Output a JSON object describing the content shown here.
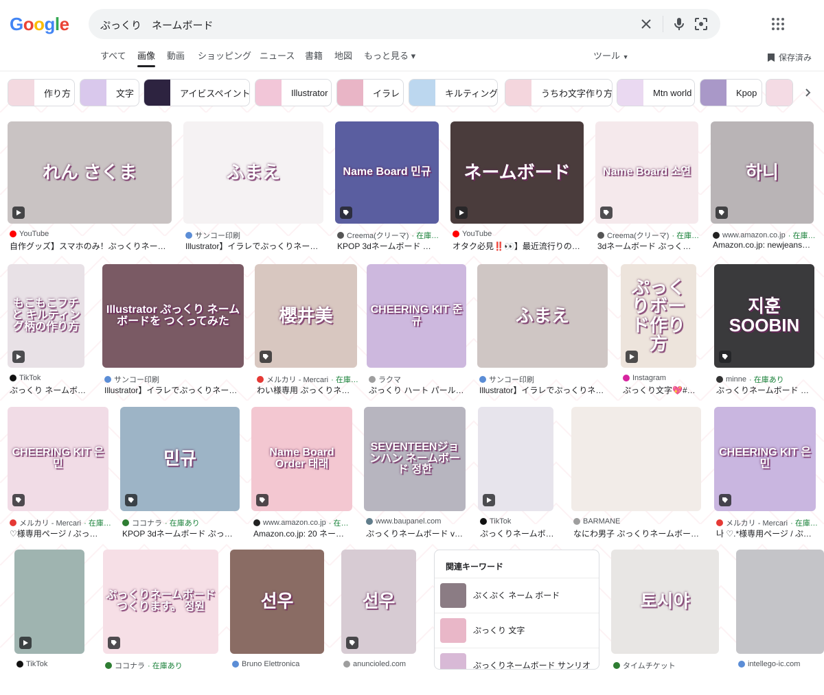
{
  "logo": {
    "letters": [
      "G",
      "o",
      "o",
      "g",
      "l",
      "e"
    ],
    "colors": [
      "#4285F4",
      "#EA4335",
      "#FBBC05",
      "#4285F4",
      "#34A853",
      "#EA4335"
    ]
  },
  "search": {
    "query": "ぷっくり　ネームボード"
  },
  "tabs": [
    {
      "label": "すべて",
      "active": false
    },
    {
      "label": "画像",
      "active": true
    },
    {
      "label": "動画",
      "active": false
    },
    {
      "label": "ショッピング",
      "active": false
    },
    {
      "label": "ニュース",
      "active": false
    },
    {
      "label": "書籍",
      "active": false
    },
    {
      "label": "地図",
      "active": false
    },
    {
      "label": "もっと見る",
      "active": false
    }
  ],
  "tools_label": "ツール",
  "saved_label": "保存済み",
  "chips": [
    {
      "label": "作り方",
      "color": "#f3d9e0"
    },
    {
      "label": "文字",
      "color": "#d9c8ec"
    },
    {
      "label": "アイビスペイント",
      "color": "#2d2340"
    },
    {
      "label": "Illustrator",
      "color": "#f2c6d8"
    },
    {
      "label": "イラレ",
      "color": "#e9b5c6"
    },
    {
      "label": "キルティング",
      "color": "#bcd7ef"
    },
    {
      "label": "うちわ文字作り方",
      "color": "#f4d6dd"
    },
    {
      "label": "Mtn world",
      "color": "#ead9f1"
    },
    {
      "label": "Kpop",
      "color": "#a998c8"
    },
    {
      "label": "",
      "color": "#f4dbe4"
    }
  ],
  "results": [
    {
      "source": "YouTube",
      "stock": "",
      "title": "自作グッズ】スマホのみ！ぷっくりネー…",
      "overlay": "れん さくま",
      "bg": "#c9c3c3",
      "fav": "#ff0000",
      "badge": "play"
    },
    {
      "source": "サンコー印刷",
      "stock": "",
      "title": "Illustrator】イラレでぷっくりネー…",
      "overlay": "ふまえ",
      "bg": "#f5f2f3",
      "fav": "#5b8dd6",
      "badge": ""
    },
    {
      "source": "Creema(クリーマ)",
      "stock": "在庫…",
      "title": "KPOP 3dネームボード …",
      "overlay": "Name Board 민규",
      "bg": "#5a5ea0",
      "fav": "#555555",
      "badge": "tag"
    },
    {
      "source": "YouTube",
      "stock": "",
      "title": "オタク必見‼️👀】最近流行りの…",
      "overlay": "ネームボード",
      "bg": "#4a3c3c",
      "fav": "#ff0000",
      "badge": "play"
    },
    {
      "source": "Creema(クリーマ)",
      "stock": "在庫…",
      "title": "3dネームボード ぷっく…",
      "overlay": "Name Board 소연",
      "bg": "#f5e9ec",
      "fav": "#555555",
      "badge": "tag"
    },
    {
      "source": "www.amazon.co.jp",
      "stock": "在庫…",
      "title": "Amazon.co.jp: newjeans…",
      "overlay": "하니",
      "bg": "#b9b4b6",
      "fav": "#222222",
      "badge": "tag"
    },
    {
      "source": "TikTok",
      "stock": "",
      "title": "ぷっくり ネームボ…",
      "overlay": "もこもこフチと キルティング柄の作り方",
      "bg": "#e8e1e6",
      "fav": "#111111",
      "badge": "play"
    },
    {
      "source": "サンコー印刷",
      "stock": "",
      "title": "Illustrator】イラレでぷっくりネー…",
      "overlay": "Illustrator ぷっくり ネームボードを つくってみた",
      "bg": "#7a5a64",
      "fav": "#5b8dd6",
      "badge": ""
    },
    {
      "source": "メルカリ - Mercari",
      "stock": "在庫…",
      "title": "わい様専用 ぷっくりネ…",
      "overlay": "櫻井美",
      "bg": "#d8c7c0",
      "fav": "#e53935",
      "badge": "tag"
    },
    {
      "source": "ラクマ",
      "stock": "",
      "title": "ぷっくり ハート パール…",
      "overlay": "CHEERING KIT 준규",
      "bg": "#cdb8de",
      "fav": "#9e9e9e",
      "badge": ""
    },
    {
      "source": "サンコー印刷",
      "stock": "",
      "title": "Illustrator】イラレでぷっくりネ…",
      "overlay": "ふまえ",
      "bg": "#cfc6c4",
      "fav": "#5b8dd6",
      "badge": ""
    },
    {
      "source": "Instagram",
      "stock": "",
      "title": "ぷっくり文字💖#…",
      "overlay": "ぷっくりボード作り方",
      "bg": "#ede4dc",
      "fav": "#d6249f",
      "badge": "play"
    },
    {
      "source": "minne",
      "stock": "在庫あり",
      "title": "ぷっくりネームボード …",
      "overlay": "지훈 SOOBIN",
      "bg": "#3a3a3c",
      "fav": "#333333",
      "badge": "tag"
    },
    {
      "source": "メルカリ - Mercari",
      "stock": "在庫…",
      "title": "♡様専用ページ / ぷっ…",
      "overlay": "CHEERING KIT 은민",
      "bg": "#f1dce6",
      "fav": "#e53935",
      "badge": "tag"
    },
    {
      "source": "ココナラ",
      "stock": "在庫あり",
      "title": "KPOP 3dネームボード ぷっ…",
      "overlay": "민규",
      "bg": "#9db4c6",
      "fav": "#2e7d32",
      "badge": "tag"
    },
    {
      "source": "www.amazon.co.jp",
      "stock": "在…",
      "title": "Amazon.co.jp: 20 ネー…",
      "overlay": "Name Board Order 태래",
      "bg": "#f3c7d1",
      "fav": "#222222",
      "badge": "tag"
    },
    {
      "source": "www.baupanel.com",
      "stock": "",
      "title": "ぷっくりネームボード v…",
      "overlay": "SEVENTEENジョンハン ネームボード 정한",
      "bg": "#b7b5bf",
      "fav": "#607d8b",
      "badge": ""
    },
    {
      "source": "TikTok",
      "stock": "",
      "title": "ぷっくりネームボ…",
      "overlay": "",
      "bg": "#e7e4ec",
      "fav": "#111111",
      "badge": "play"
    },
    {
      "source": "BARMANE",
      "stock": "",
      "title": "なにわ男子 ぷっくりネームボー…",
      "overlay": "",
      "bg": "#f2ece8",
      "fav": "#9e9e9e",
      "badge": ""
    },
    {
      "source": "メルカリ - Mercari",
      "stock": "在庫…",
      "title": "나 ♡.*様専用ページ / ぷ…",
      "overlay": "CHEERING KIT 은민",
      "bg": "#c9b6e0",
      "fav": "#e53935",
      "badge": "tag"
    },
    {
      "source": "TikTok",
      "stock": "",
      "title": "",
      "overlay": "",
      "bg": "#9fb4b0",
      "fav": "#111111",
      "badge": "play"
    },
    {
      "source": "ココナラ",
      "stock": "在庫あり",
      "title": "",
      "overlay": "ぷっくりネームボード つくります。 정원",
      "bg": "#f6dfe6",
      "fav": "#2e7d32",
      "badge": "tag"
    },
    {
      "source": "Bruno Elettronica",
      "stock": "",
      "title": "",
      "overlay": "선우",
      "bg": "#8a6c64",
      "fav": "#5b8dd6",
      "badge": ""
    },
    {
      "source": "anuncioled.com",
      "stock": "",
      "title": "",
      "overlay": "선우",
      "bg": "#d7cbd3",
      "fav": "#9e9e9e",
      "badge": "tag"
    },
    {
      "source": "タイムチケット",
      "stock": "",
      "title": "",
      "overlay": "토시야",
      "bg": "#e8e6e4",
      "fav": "#2e7d32",
      "badge": ""
    },
    {
      "source": "intellego-ic.com",
      "stock": "",
      "title": "",
      "overlay": "",
      "bg": "#c4c4c8",
      "fav": "#5b8dd6",
      "badge": ""
    }
  ],
  "related": {
    "heading": "関連キーワード",
    "items": [
      {
        "label": "ぷくぷく ネーム ボード",
        "color": "#8b7c84"
      },
      {
        "label": "ぷっくり 文字",
        "color": "#e9b7c8"
      },
      {
        "label": "ぷっくりネームボード サンリオ",
        "color": "#d8b9d6"
      }
    ]
  }
}
